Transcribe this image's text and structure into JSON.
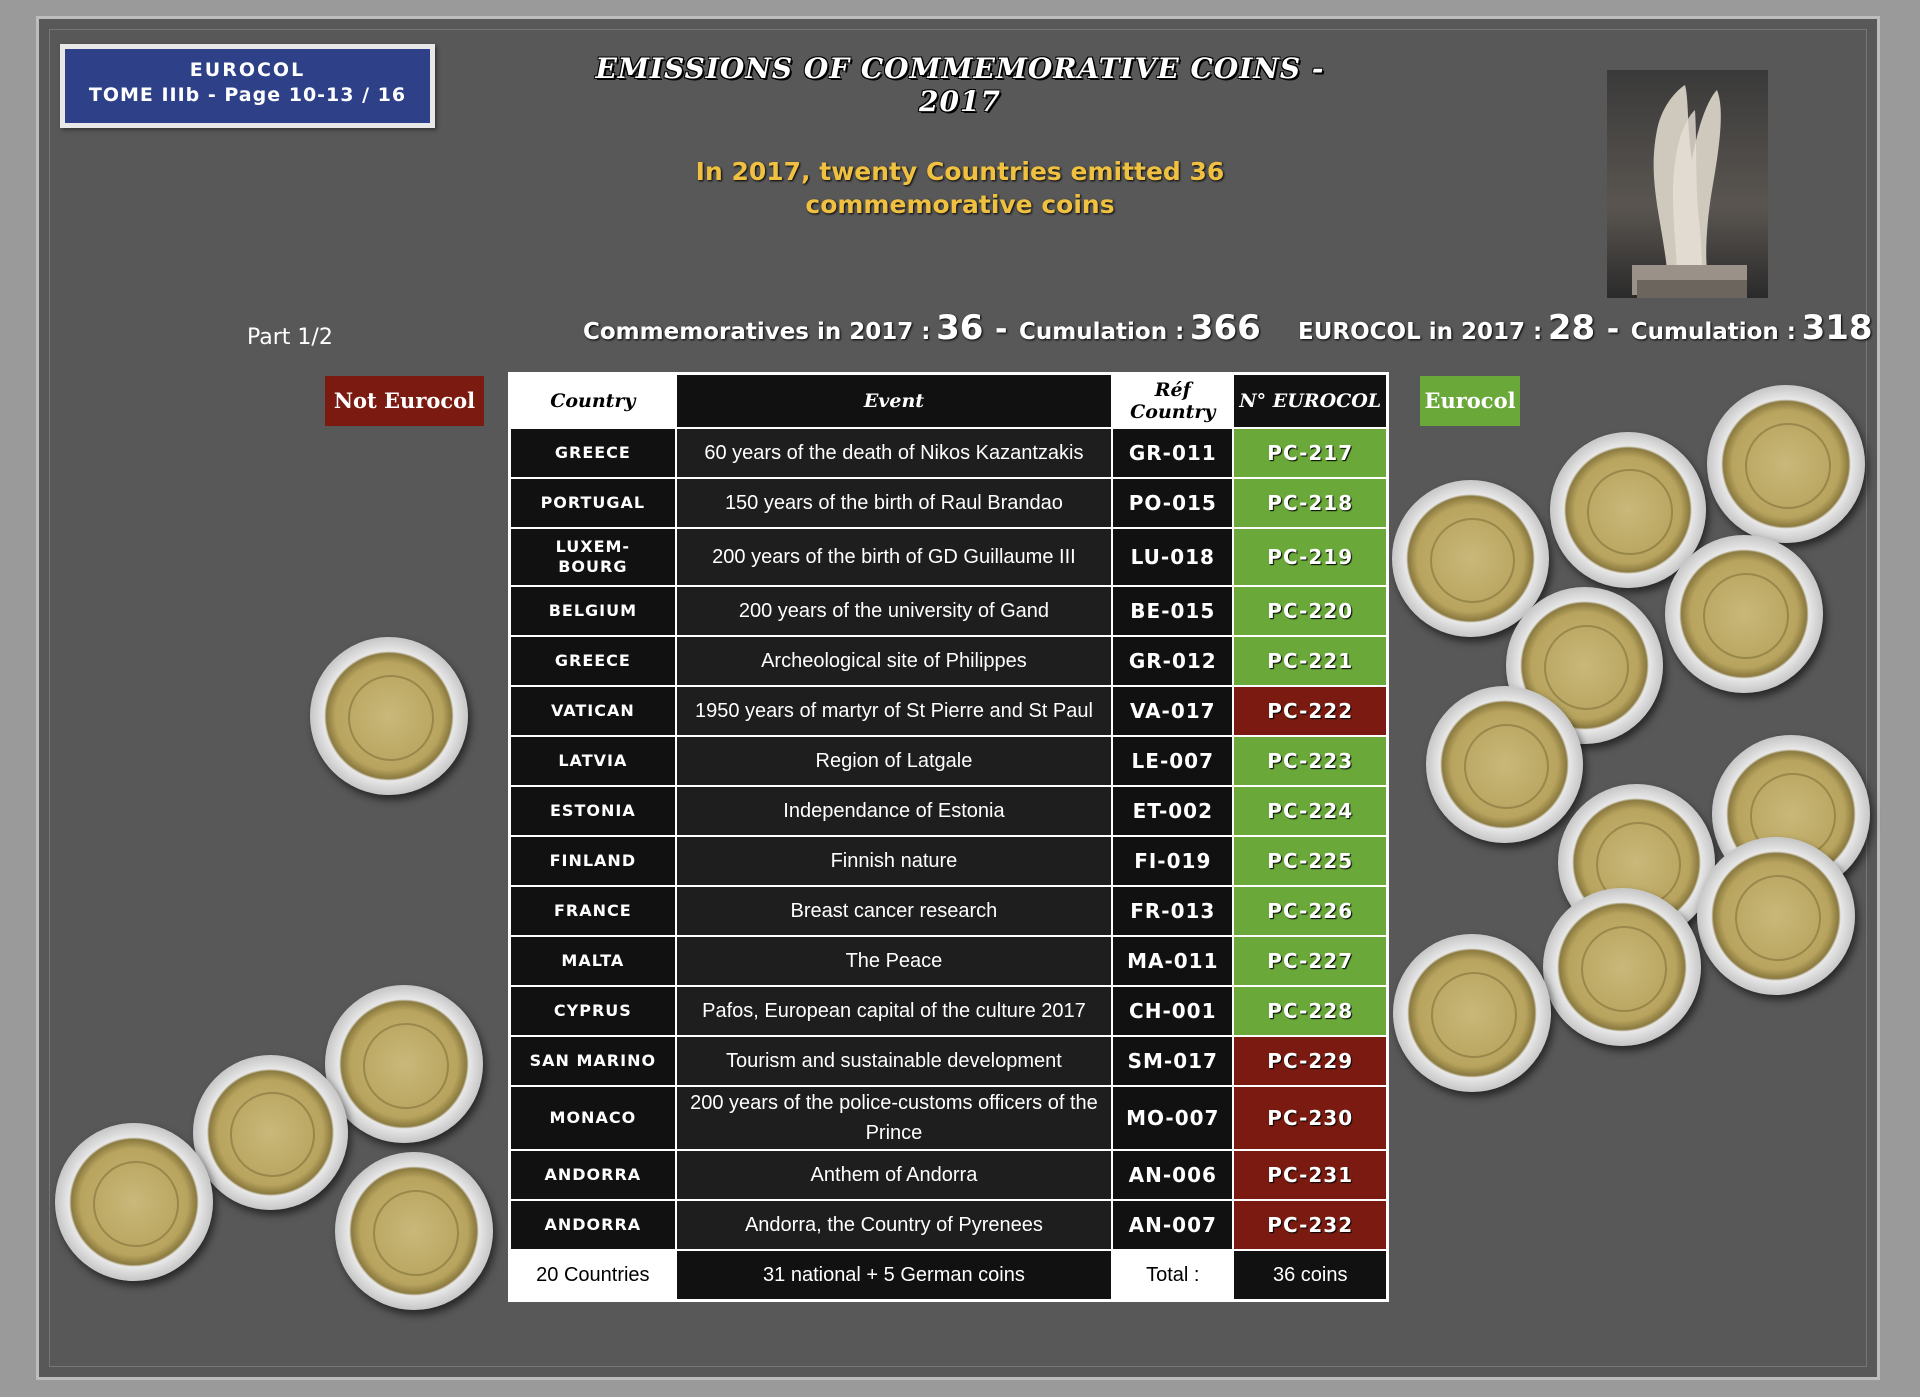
{
  "badge": {
    "line1": "EUROCOL",
    "line2": "TOME IIIb - Page 10-13 / 16"
  },
  "title": "EMISSIONS OF COMMEMORATIVE COINS - 2017",
  "subtitle": {
    "line1": "In 2017, twenty Countries emitted 36",
    "line2": "commemorative coins"
  },
  "part": "Part 1/2",
  "stats_left": {
    "label1": "Commemoratives in 2017 :",
    "value1": "36",
    "dash": "-",
    "label2": "Cumulation :",
    "value2": "366"
  },
  "stats_right": {
    "label1": "EUROCOL in 2017 :",
    "value1": "28",
    "dash": "-",
    "label2": "Cumulation :",
    "value2": "318"
  },
  "tags": {
    "not_eurocol": "Not Eurocol",
    "eurocol": "Eurocol"
  },
  "table": {
    "headers": {
      "country": "Country",
      "event": "Event",
      "ref": "Réf Country",
      "num": "N° EUROCOL"
    },
    "rows": [
      {
        "country": "GREECE",
        "event": "60 years of the death of Nikos Kazantzakis",
        "ref": "GR-011",
        "num": "PC-217",
        "eurocol": true
      },
      {
        "country": "PORTUGAL",
        "event": "150 years of the birth of Raul Brandao",
        "ref": "PO-015",
        "num": "PC-218",
        "eurocol": true
      },
      {
        "country": "LUXEM-",
        "country2": "BOURG",
        "event": "200 years of the birth of GD Guillaume III",
        "ref": "LU-018",
        "num": "PC-219",
        "eurocol": true
      },
      {
        "country": "BELGIUM",
        "event": "200 years of the university of Gand",
        "ref": "BE-015",
        "num": "PC-220",
        "eurocol": true
      },
      {
        "country": "GREECE",
        "event": "Archeological site of Philippes",
        "ref": "GR-012",
        "num": "PC-221",
        "eurocol": true
      },
      {
        "country": "VATICAN",
        "event": "1950 years of martyr of St Pierre and St Paul",
        "ref": "VA-017",
        "num": "PC-222",
        "eurocol": false
      },
      {
        "country": "LATVIA",
        "event": "Region of Latgale",
        "ref": "LE-007",
        "num": "PC-223",
        "eurocol": true
      },
      {
        "country": "ESTONIA",
        "event": "Independance of Estonia",
        "ref": "ET-002",
        "num": "PC-224",
        "eurocol": true
      },
      {
        "country": "FINLAND",
        "event": "Finnish nature",
        "ref": "FI-019",
        "num": "PC-225",
        "eurocol": true
      },
      {
        "country": "FRANCE",
        "event": "Breast cancer research",
        "ref": "FR-013",
        "num": "PC-226",
        "eurocol": true
      },
      {
        "country": "MALTA",
        "event": "The Peace",
        "ref": "MA-011",
        "num": "PC-227",
        "eurocol": true
      },
      {
        "country": "CYPRUS",
        "event": "Pafos, European capital of the culture 2017",
        "ref": "CH-001",
        "num": "PC-228",
        "eurocol": true
      },
      {
        "country": "SAN MARINO",
        "event": "Tourism and sustainable development",
        "ref": "SM-017",
        "num": "PC-229",
        "eurocol": false
      },
      {
        "country": "MONACO",
        "event": "200 years of the police-customs officers of the",
        "event2": "Prince",
        "ref": "MO-007",
        "num": "PC-230",
        "eurocol": false
      },
      {
        "country": "ANDORRA",
        "event": "Anthem of Andorra",
        "ref": "AN-006",
        "num": "PC-231",
        "eurocol": false
      },
      {
        "country": "ANDORRA",
        "event": "Andorra, the Country of Pyrenees",
        "ref": "AN-007",
        "num": "PC-232",
        "eurocol": false
      }
    ],
    "footer": {
      "countries": "20  Countries",
      "coins": "31  national + 5 German coins",
      "total_label": "Total :",
      "total": "36  coins"
    }
  },
  "colors": {
    "eurocol_green": "#6aa83a",
    "not_eurocol_red": "#7a1a10",
    "badge_blue": "#2d4088",
    "subtitle_gold": "#f0c040"
  }
}
